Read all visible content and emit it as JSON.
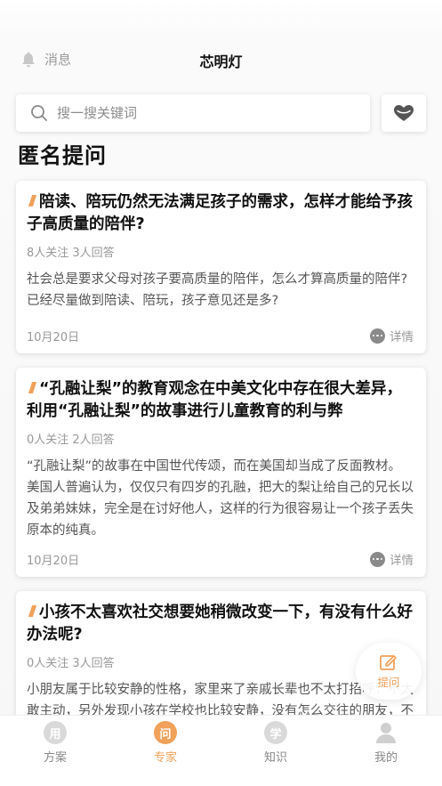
{
  "header": {
    "messages_label": "消息",
    "title": "芯明灯"
  },
  "search": {
    "placeholder": "搜一搜关键词"
  },
  "section": {
    "title": "匿名提问"
  },
  "cards": [
    {
      "title": "陪读、陪玩仍然无法满足孩子的需求，怎样才能给予孩子高质量的陪伴?",
      "meta": "8人关注 3人回答",
      "desc": "社会总是要求父母对孩子要高质量的陪伴，怎么才算高质量的陪伴? 已经尽量做到陪读、陪玩，孩子意见还是多?",
      "date": "10月20日",
      "detail": "详情"
    },
    {
      "title": "“孔融让梨”的教育观念在中美文化中存在很大差异，利用“孔融让梨”的故事进行儿童教育的利与弊",
      "meta": "0人关注 2人回答",
      "desc": "“孔融让梨”的故事在中国世代传颂，而在美国却当成了反面教材。美国人普遍认为，仅仅只有四岁的孔融，把大的梨让给自己的兄长以及弟弟妹妹，完全是在讨好他人，这样的行为很容易让一个孩子丢失原本的纯真。",
      "date": "10月20日",
      "detail": "详情"
    },
    {
      "title": "小孩不太喜欢社交想要她稍微改变一下，有没有什么好办法呢?",
      "meta": "0人关注 3人回答",
      "desc": "小朋友属于比较安静的性格，家里来了亲戚长辈也不太打招呼，不太敢主动，另外发现小孩在学校也比较安静，没有怎么交往的朋友，不知道小朋友是不是得了太害羞的",
      "date": "",
      "detail": ""
    }
  ],
  "fab": {
    "label": "提问"
  },
  "tabs": [
    {
      "icon_text": "用",
      "label": "方案"
    },
    {
      "icon_text": "问",
      "label": "专家"
    },
    {
      "icon_text": "学",
      "label": "知识"
    },
    {
      "icon_text": "",
      "label": "我的"
    }
  ],
  "colors": {
    "accent": "#f0a15a"
  }
}
